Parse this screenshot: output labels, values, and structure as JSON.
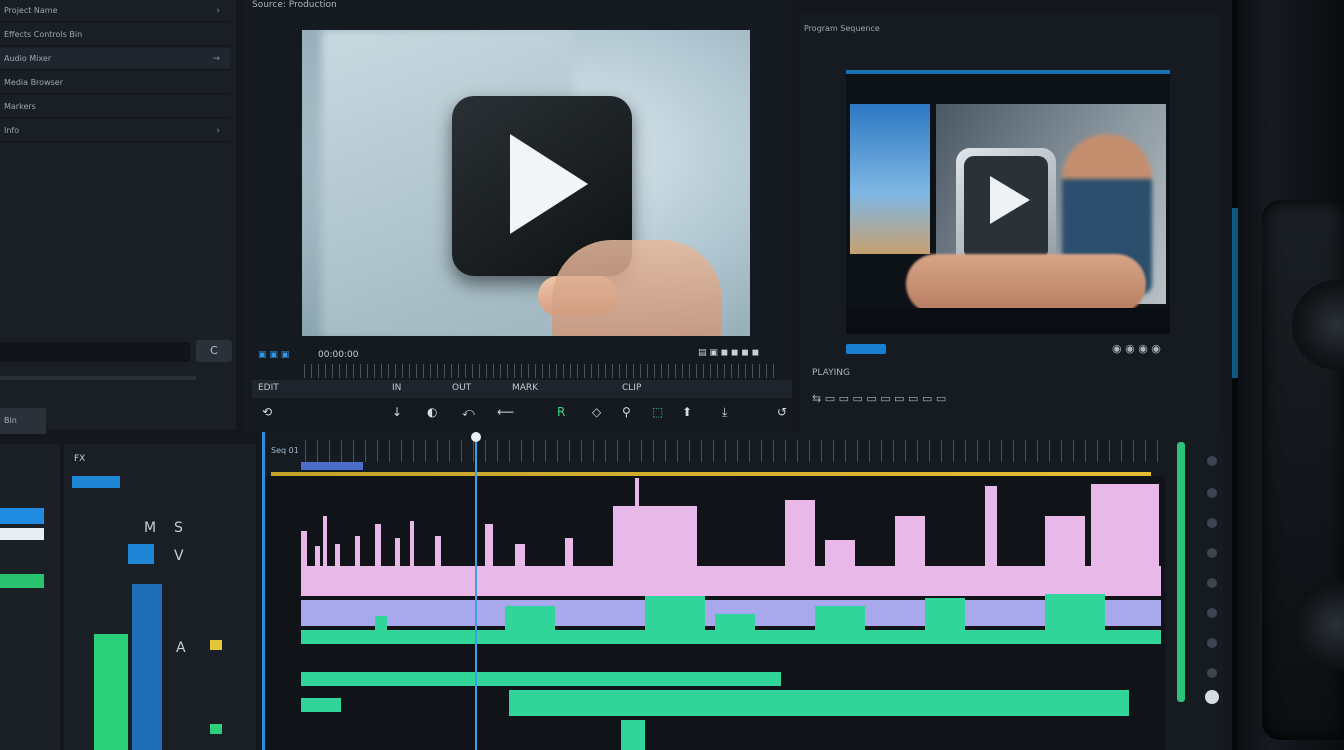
{
  "source_monitor": {
    "title": "Source: Production",
    "controls_label": "00:00:00",
    "btn_row": [
      "EDIT",
      "IN",
      "OUT",
      "MARK",
      "CLIP"
    ],
    "tools": [
      "⟲",
      "↓",
      "◐",
      "⤺",
      "⟵",
      "R",
      "◇",
      "⚲",
      "⬚",
      "⬆",
      "⤓",
      "↺"
    ]
  },
  "program_monitor": {
    "title": "Program Sequence",
    "status": "PLAYING"
  },
  "left_panel": {
    "rows": [
      "Project Name",
      "Effects Controls Bin",
      "Audio Mixer",
      "Media Browser",
      "Markers",
      "Info"
    ],
    "tab_label": "Bin",
    "search_btn": "C"
  },
  "mixer": {
    "labels": [
      "FX",
      "M",
      "S",
      "V",
      "A"
    ]
  },
  "timeline": {
    "label": "Seq 01"
  },
  "colors": {
    "accent_blue": "#2590d7",
    "pink_track": "#e8b8e8",
    "violet_track": "#a9a8ec",
    "green_track": "#31d59a",
    "yellow_bar": "#e4bf33"
  }
}
